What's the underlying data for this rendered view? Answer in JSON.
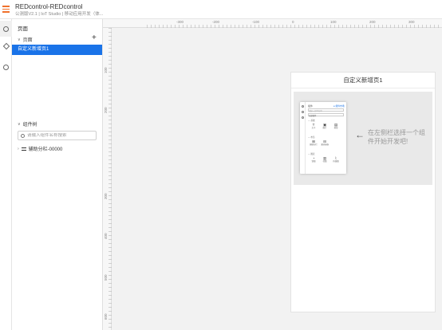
{
  "header": {
    "title": "REDcontrol-REDcontrol",
    "subtitle": "公测版V2.1 | IoT Studio | 移动应用开发（体..."
  },
  "rail": {
    "items": [
      "gear-icon",
      "cube-icon",
      "settings-icon"
    ]
  },
  "panel": {
    "title": "页面",
    "pages_section": "页面",
    "add_symbol": "+",
    "pages": [
      "自定义新增页1"
    ],
    "components_section": "组件树",
    "search_placeholder": "请输入组件名称搜索",
    "tree_items": [
      "辅助分栏-00000"
    ]
  },
  "ruler": {
    "top_labels": [
      "-300",
      "-200",
      "-100",
      "0",
      "100",
      "200",
      "300"
    ],
    "left_labels": [
      "100",
      "200",
      "300",
      "400",
      "500",
      "600"
    ]
  },
  "canvas": {
    "page_title": "自定义新增页1",
    "hint_arrow": "←",
    "hint_text": "在左侧栏选择一个组件开始开发吧!"
  },
  "mini_preview": {
    "rail_title": "组件",
    "badge": "● 组件市场",
    "search_placeholder": "请输入组件名称",
    "filter_label": "全部组件",
    "section_basic": "— 基础",
    "basic_items": [
      {
        "glyph": "T",
        "label": "文字"
      },
      {
        "glyph": "▣",
        "label": "图片"
      },
      {
        "glyph": "▤",
        "label": "按钮"
      }
    ],
    "section_layout": "— 布局",
    "layout_items": [
      {
        "glyph": "⊞",
        "label": "辅助分栏"
      },
      {
        "glyph": "⊟",
        "label": "滚动容器"
      }
    ],
    "section_chart": "— 图表",
    "chart_items": [
      {
        "glyph": "◔",
        "label": "饼图"
      },
      {
        "glyph": "▥",
        "label": "柱图"
      },
      {
        "glyph": "⌇",
        "label": "折线图"
      }
    ]
  },
  "colors": {
    "accent": "#1a73e8",
    "brand": "#f0712c",
    "canvas_bg": "#f2f2f2"
  }
}
